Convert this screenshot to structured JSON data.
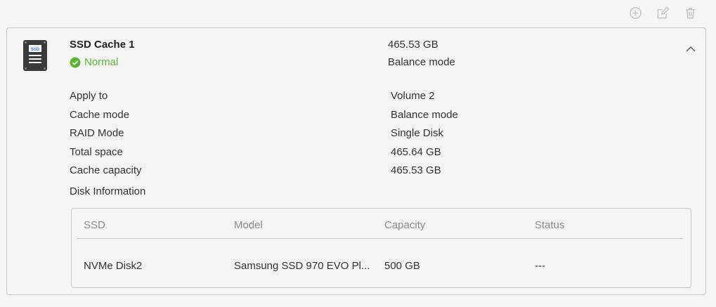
{
  "toolbar": {
    "add_icon": "plus-circle",
    "edit_icon": "edit",
    "delete_icon": "trash"
  },
  "cache": {
    "title": "SSD Cache 1",
    "status": "Normal",
    "status_color": "#5eb52e",
    "capacity": "465.53 GB",
    "mode": "Balance mode",
    "icon_label": "SSD"
  },
  "details": [
    {
      "label": "Apply to",
      "value": "Volume 2"
    },
    {
      "label": "Cache mode",
      "value": "Balance mode"
    },
    {
      "label": "RAID Mode",
      "value": "Single Disk"
    },
    {
      "label": "Total space",
      "value": "465.64 GB"
    },
    {
      "label": "Cache capacity",
      "value": "465.53 GB"
    }
  ],
  "disk_info": {
    "heading": "Disk Information",
    "columns": [
      "SSD",
      "Model",
      "Capacity",
      "Status"
    ],
    "rows": [
      [
        "NVMe Disk2",
        "Samsung SSD 970 EVO Pl...",
        "500 GB",
        "---"
      ]
    ]
  }
}
